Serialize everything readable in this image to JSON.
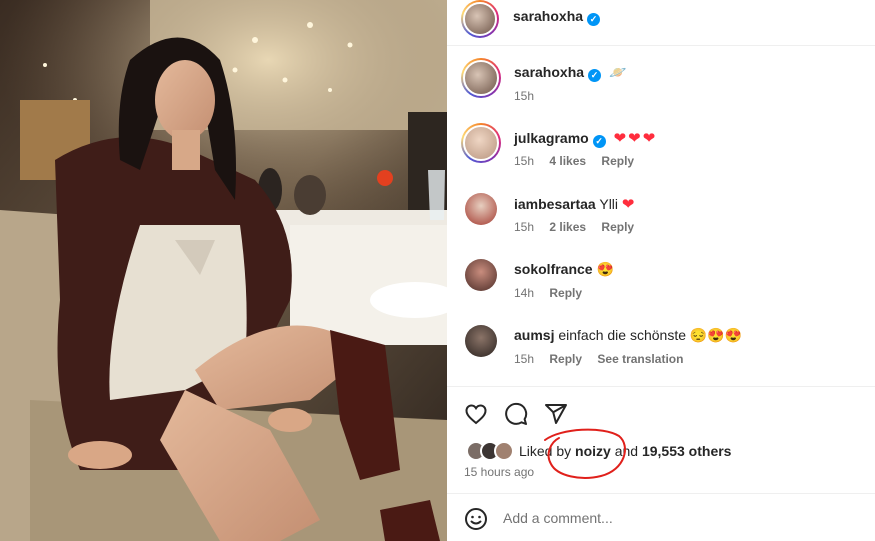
{
  "post": {
    "author": "sarahoxha",
    "verified": true
  },
  "comments": [
    {
      "username": "sarahoxha",
      "verified": true,
      "text": "",
      "emoji": "🪐",
      "time": "15h",
      "likes": "",
      "reply": "",
      "translation": ""
    },
    {
      "username": "julkagramo",
      "verified": true,
      "text": "",
      "emoji": "❤❤❤",
      "time": "15h",
      "likes": "4 likes",
      "reply": "Reply",
      "translation": ""
    },
    {
      "username": "iambesartaa",
      "verified": false,
      "text": "Ylli",
      "emoji": "❤",
      "time": "15h",
      "likes": "2 likes",
      "reply": "Reply",
      "translation": ""
    },
    {
      "username": "sokolfrance",
      "verified": false,
      "text": "",
      "emoji": "😍",
      "time": "14h",
      "likes": "",
      "reply": "Reply",
      "translation": ""
    },
    {
      "username": "aumsj",
      "verified": false,
      "text": "einfach die schönste",
      "emoji": "😔😍😍",
      "time": "15h",
      "likes": "",
      "reply": "Reply",
      "translation": "See translation"
    }
  ],
  "actions": {
    "like_icon": "heart-outline-icon",
    "comment_icon": "speech-bubble-icon",
    "share_icon": "paper-plane-icon"
  },
  "likes": {
    "prefix": "Liked by",
    "user": "noizy",
    "joiner": "and",
    "others": "19,553 others"
  },
  "time_ago": "15 hours ago",
  "add_comment": {
    "placeholder": "Add a comment...",
    "emoji_icon": "smiley-icon"
  },
  "colors": {
    "accent": "#0095f6",
    "heart": "#ff2d3d",
    "annotation": "#e0201b"
  }
}
